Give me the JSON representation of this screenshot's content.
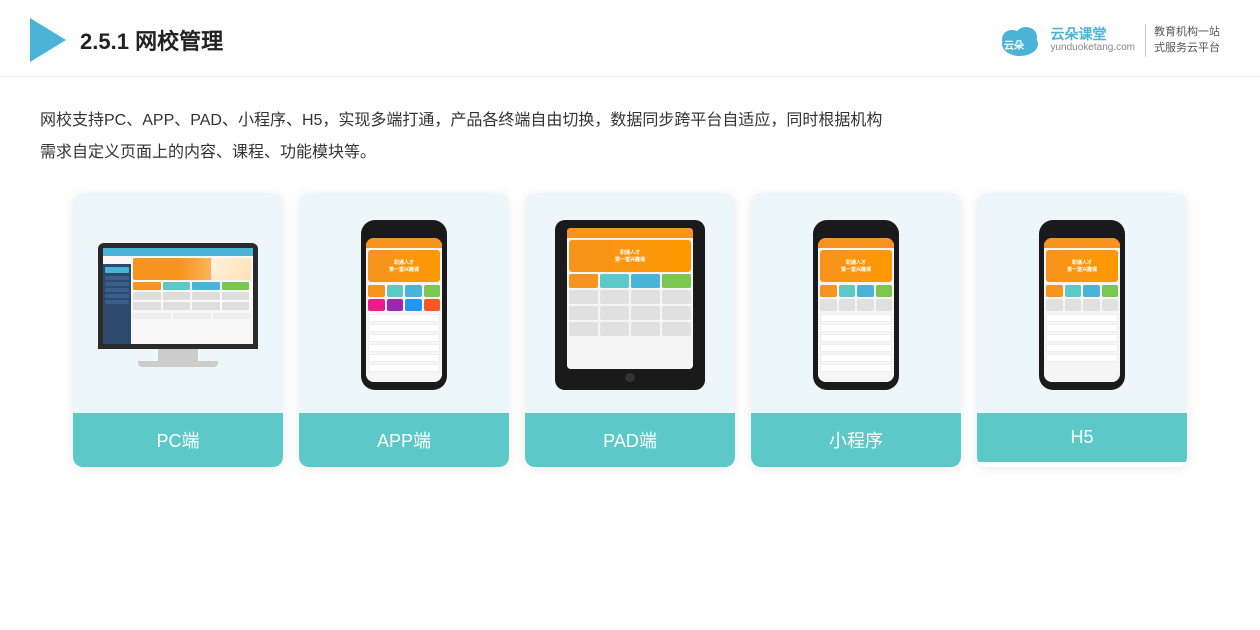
{
  "header": {
    "section_number": "2.5.1",
    "section_title": "网校管理",
    "brand": {
      "name": "云朵课堂",
      "url": "yunduoketang.com",
      "slogan_line1": "教育机构一站",
      "slogan_line2": "式服务云平台"
    }
  },
  "description": {
    "line1": "网校支持PC、APP、PAD、小程序、H5，实现多端打通，产品各终端自由切换，数据同步跨平台自适应，同时根据机构",
    "line2": "需求自定义页面上的内容、课程、功能模块等。"
  },
  "cards": [
    {
      "id": "pc",
      "label": "PC端"
    },
    {
      "id": "app",
      "label": "APP端"
    },
    {
      "id": "pad",
      "label": "PAD端"
    },
    {
      "id": "miniprogram",
      "label": "小程序"
    },
    {
      "id": "h5",
      "label": "H5"
    }
  ]
}
